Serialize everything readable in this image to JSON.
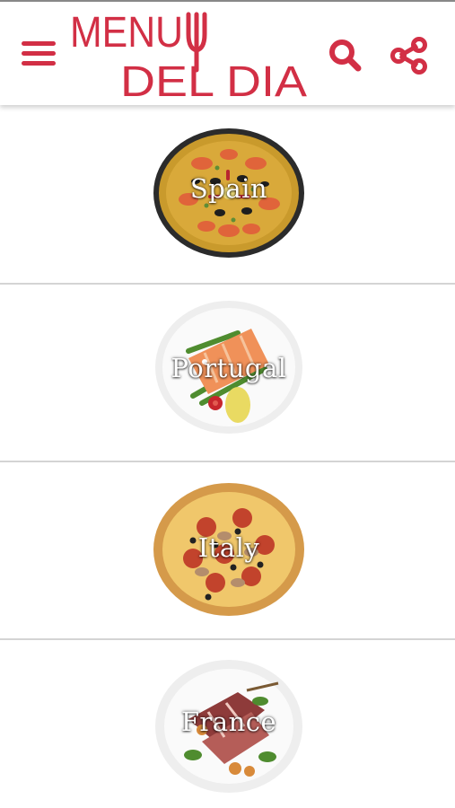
{
  "header": {
    "logo_line1": "MENU",
    "logo_line2": "DEL DIA",
    "menu_icon": "hamburger-menu-icon",
    "search_icon": "search-icon",
    "share_icon": "share-icon"
  },
  "colors": {
    "accent": "#d22f45",
    "background": "#ffffff",
    "divider": "#d4d4d4"
  },
  "countries": [
    {
      "name": "Spain",
      "dish_icon": "paella-image"
    },
    {
      "name": "Portugal",
      "dish_icon": "salmon-plate-image"
    },
    {
      "name": "Italy",
      "dish_icon": "pizza-image"
    },
    {
      "name": "France",
      "dish_icon": "steak-plate-image"
    }
  ]
}
